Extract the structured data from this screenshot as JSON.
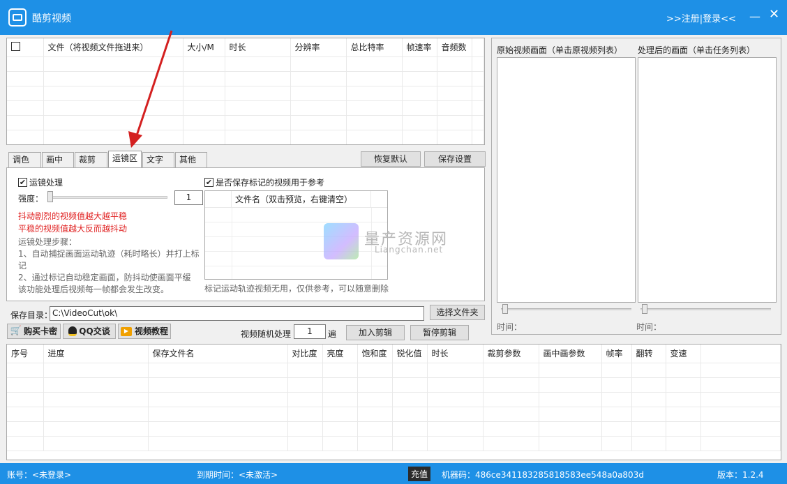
{
  "window": {
    "title": "酷剪视频",
    "login_link": ">>注册|登录<<",
    "minimize": "—",
    "close": "✕"
  },
  "file_grid": {
    "columns": [
      "",
      "文件（将视频文件拖进来）",
      "大小/M",
      "时长",
      "分辨率",
      "总比特率",
      "帧速率",
      "音频数"
    ],
    "rows": 6
  },
  "preview": {
    "original_label": "原始视频画面（单击原视频列表）",
    "processed_label": "处理后的画面（单击任务列表）",
    "time_label_left": "时间：",
    "time_label_right": "时间："
  },
  "tabs": [
    {
      "label": "调色区",
      "active": false
    },
    {
      "label": "画中画",
      "active": false
    },
    {
      "label": "裁剪区",
      "active": false
    },
    {
      "label": "运镜区",
      "active": true
    },
    {
      "label": "文字区",
      "active": false
    },
    {
      "label": "其他区",
      "active": false
    }
  ],
  "toolbar": {
    "restore_default": "恢复默认",
    "save_settings": "保存设置"
  },
  "stabilize": {
    "enable_label": "运镜处理",
    "enable_checked": true,
    "strength_label": "强度：",
    "strength_value": "1",
    "strength_level": 0,
    "warning_line1": "抖动剧烈的视频值越大越平稳",
    "warning_line2": "平稳的视频值越大反而越抖动",
    "steps_title": "运镜处理步骤：",
    "step1_a": "1、自动捕捉画面运动轨迹（耗时略长）并打上标",
    "step1_b": "记",
    "step2_a": "2、通过标记自动稳定画面，防抖动使画面平缓",
    "step2_b": "该功能处理后视频每一帧都会发生改变。",
    "save_marked_label": "是否保存标记的视频用于参考",
    "save_marked_checked": true,
    "marked_list_header": "文件名（双击预览，右键清空）",
    "marked_note": "标记运动轨迹视频无用，仅供参考，可以随意删除"
  },
  "watermark": {
    "title": "量产资源网",
    "subtitle": "Liangchan.net"
  },
  "output": {
    "save_dir_label": "保存目录：",
    "save_dir_value": "C:\\VideoCut\\ok\\",
    "choose_folder": "选择文件夹"
  },
  "actions": {
    "buy_card": "购买卡密",
    "qq_chat": "QQ交谈",
    "video_tutorial": "视频教程",
    "random_label": "视频随机处理",
    "random_value": "1",
    "random_unit": "遍",
    "add_edit": "加入剪辑",
    "pause_edit": "暂停剪辑"
  },
  "task_grid": {
    "columns": [
      "序号",
      "进度",
      "保存文件名",
      "对比度",
      "亮度",
      "饱和度",
      "锐化值",
      "时长",
      "裁剪参数",
      "画中画参数",
      "帧率",
      "翻转",
      "变速"
    ],
    "rows": 6
  },
  "status": {
    "account": "账号：<未登录>",
    "expiry": "到期时间：<未激活>",
    "recharge": "充值",
    "machine_code": "机器码：486ce341183285818583ee548a0a803d",
    "version": "版本：1.2.4"
  },
  "colors": {
    "titlebar": "#1e90e6",
    "warning_text": "#e02020",
    "arrow": "#d42020"
  }
}
